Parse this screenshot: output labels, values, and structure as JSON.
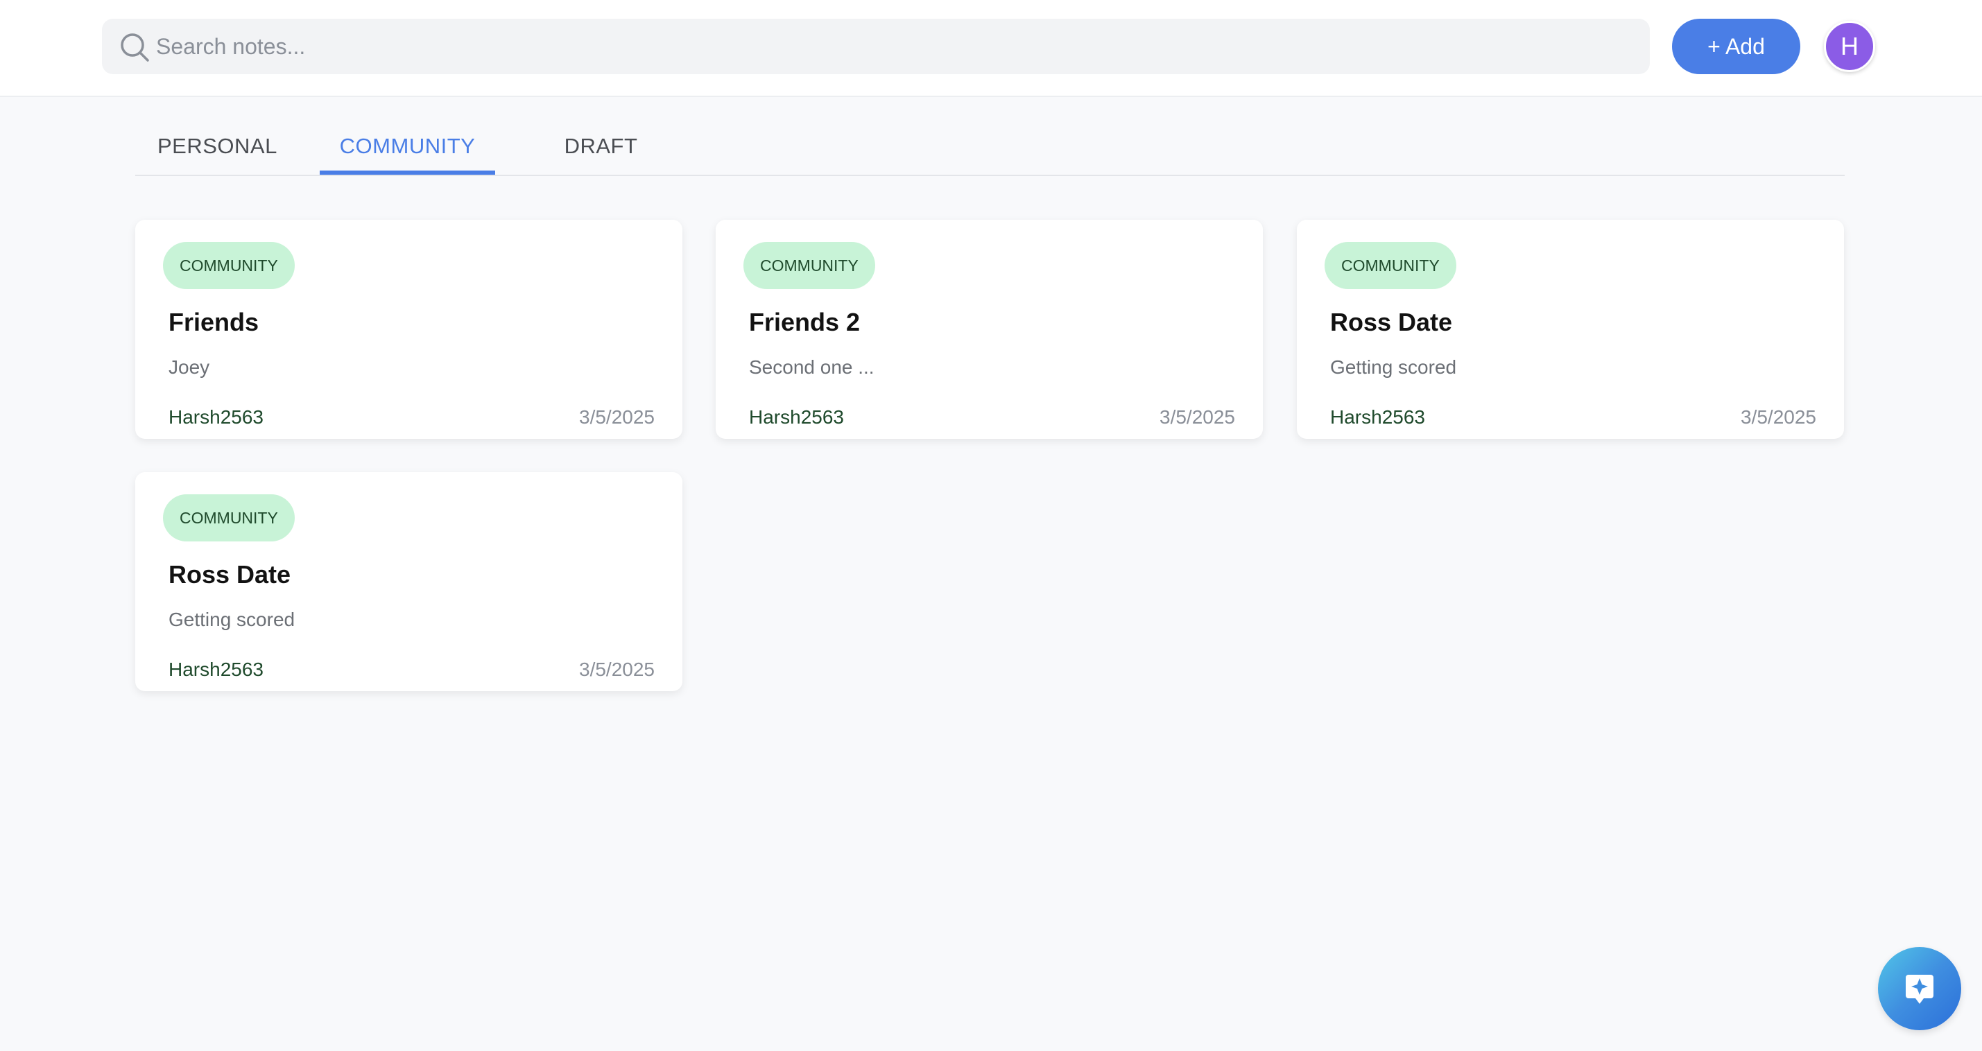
{
  "header": {
    "search_placeholder": "Search notes...",
    "add_label": "+ Add",
    "avatar_initial": "H"
  },
  "tabs": [
    {
      "label": "PERSONAL",
      "active": false
    },
    {
      "label": "COMMUNITY",
      "active": true
    },
    {
      "label": "DRAFT",
      "active": false
    }
  ],
  "cards": [
    {
      "badge": "COMMUNITY",
      "title": "Friends",
      "description": "Joey",
      "author": "Harsh2563",
      "date": "3/5/2025"
    },
    {
      "badge": "COMMUNITY",
      "title": "Friends 2",
      "description": "Second one ...",
      "author": "Harsh2563",
      "date": "3/5/2025"
    },
    {
      "badge": "COMMUNITY",
      "title": "Ross Date",
      "description": "Getting scored",
      "author": "Harsh2563",
      "date": "3/5/2025"
    },
    {
      "badge": "COMMUNITY",
      "title": "Ross Date",
      "description": "Getting scored",
      "author": "Harsh2563",
      "date": "3/5/2025"
    }
  ],
  "icons": {
    "search": "search-icon",
    "fab": "ai-sparkle-icon"
  },
  "colors": {
    "accent": "#4a7ee6",
    "avatar": "#8b5ce6",
    "badge_bg": "#c8f3d7",
    "badge_text": "#1f4a2c"
  }
}
